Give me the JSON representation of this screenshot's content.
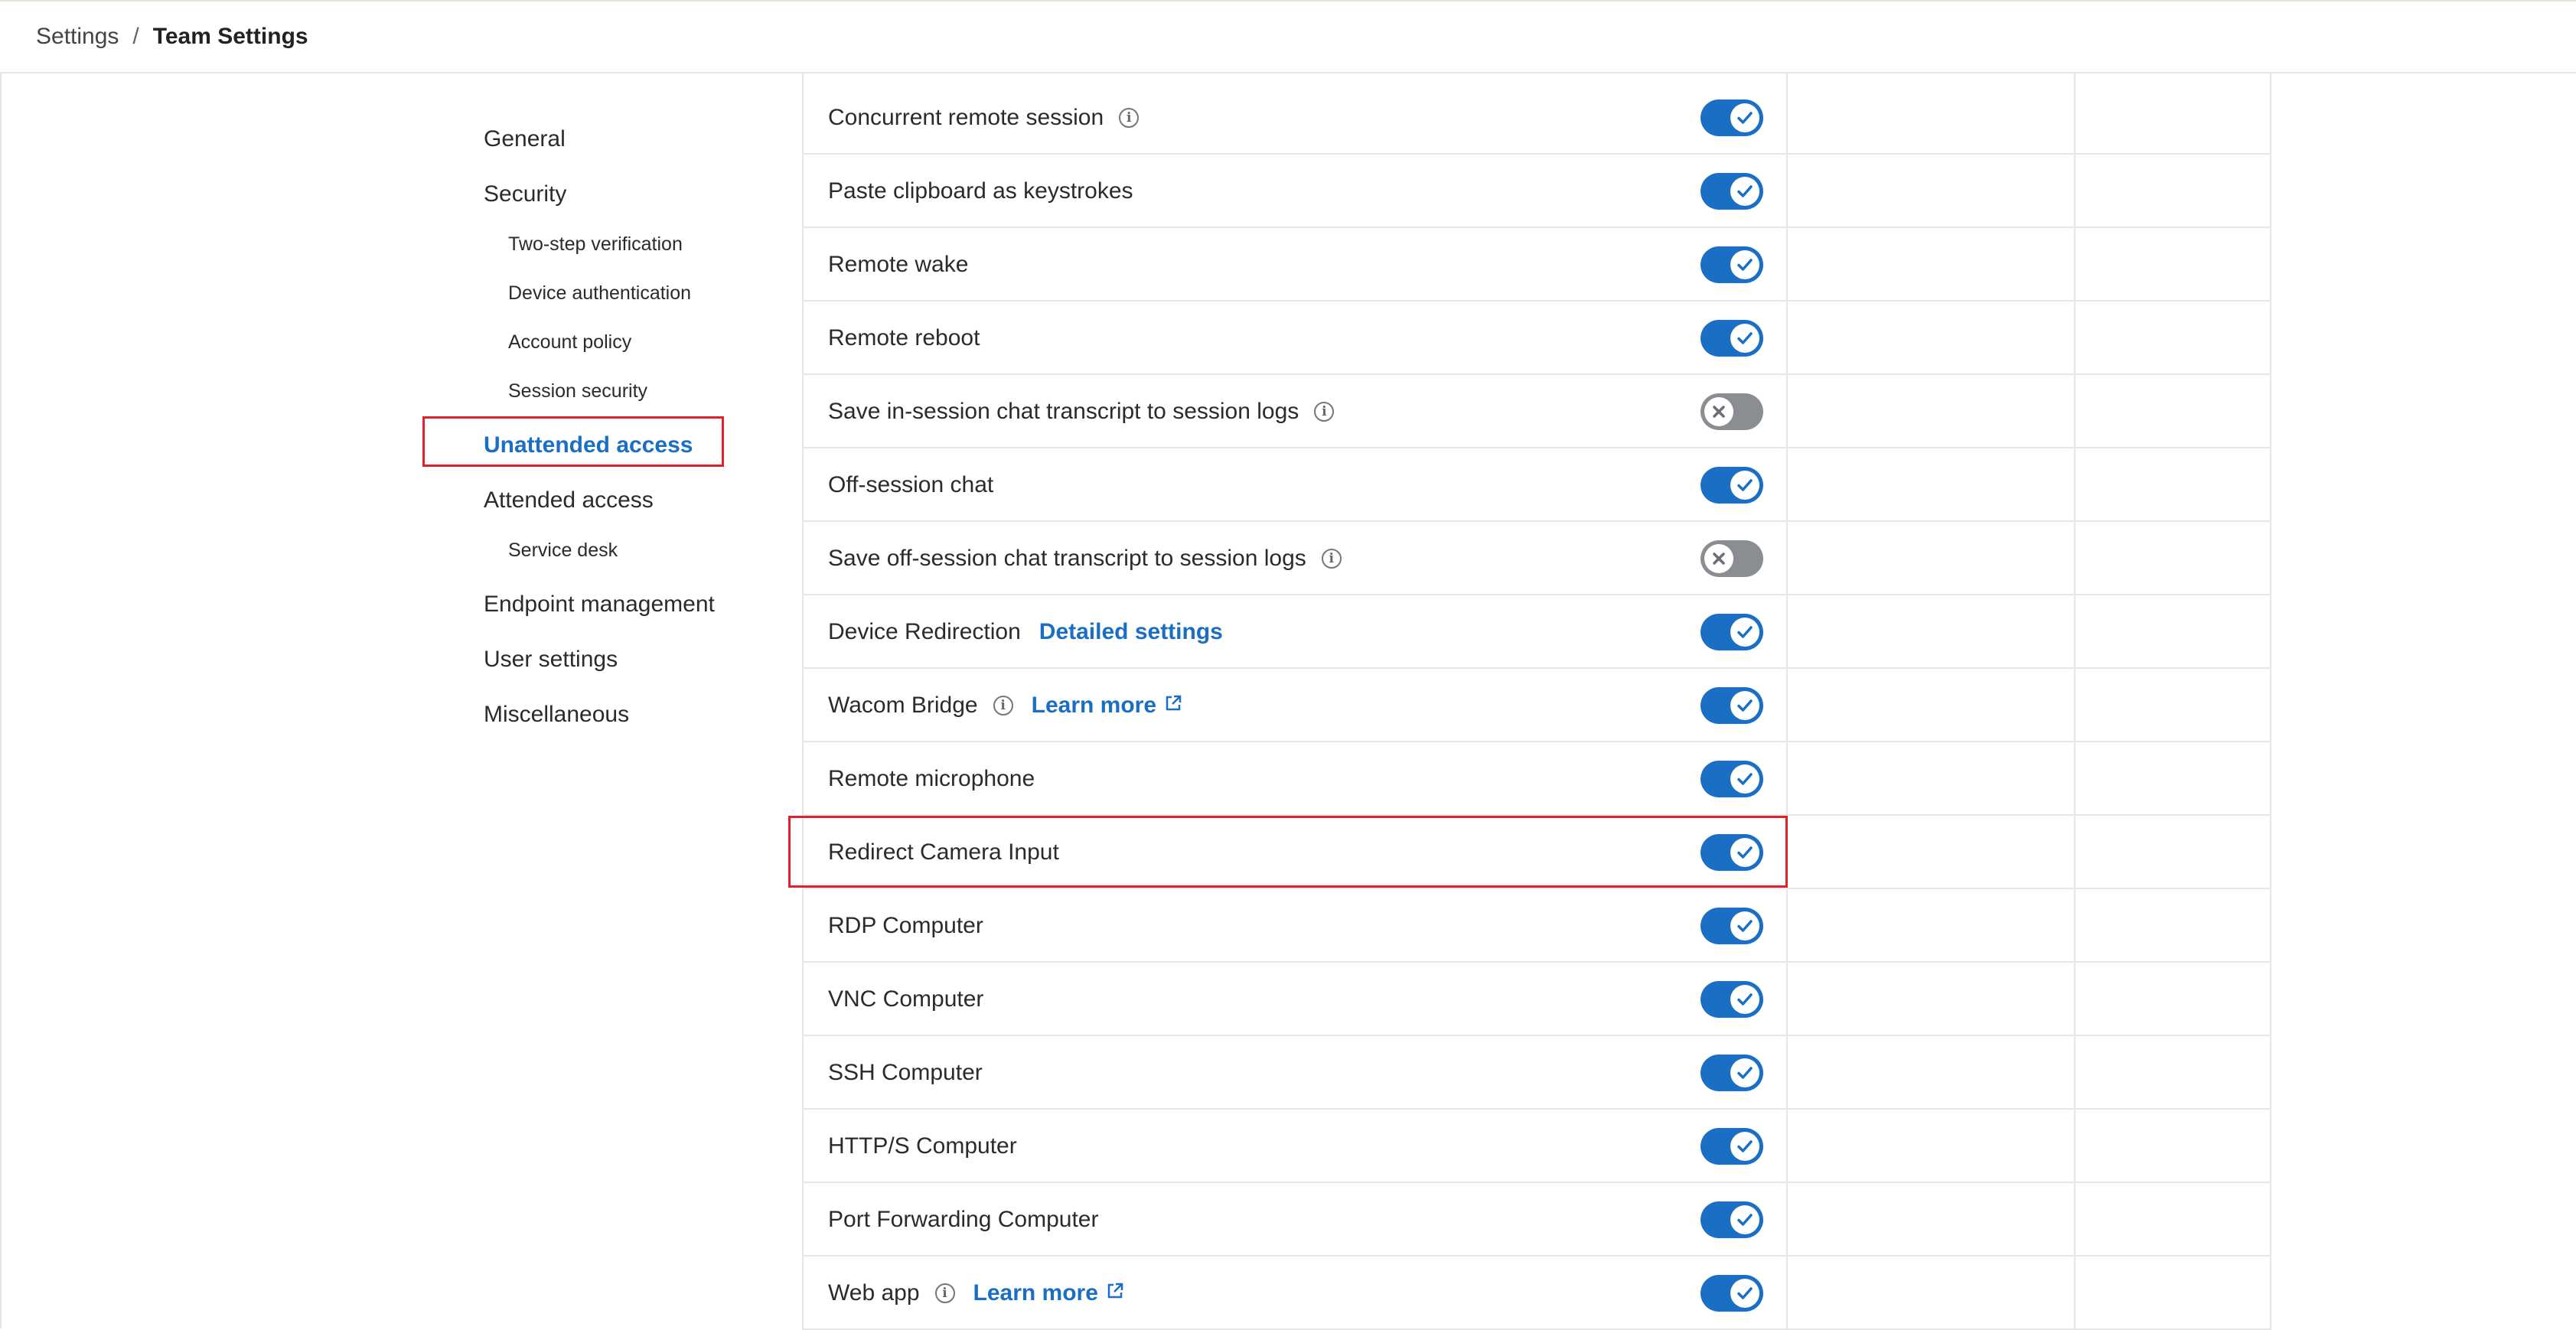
{
  "breadcrumb": {
    "root": "Settings",
    "separator": "/",
    "current": "Team Settings"
  },
  "sidebar": {
    "items": [
      {
        "label": "General",
        "level": "top",
        "active": false
      },
      {
        "label": "Security",
        "level": "top",
        "active": false
      },
      {
        "label": "Two-step verification",
        "level": "sub",
        "active": false
      },
      {
        "label": "Device authentication",
        "level": "sub",
        "active": false
      },
      {
        "label": "Account policy",
        "level": "sub",
        "active": false
      },
      {
        "label": "Session security",
        "level": "sub",
        "active": false
      },
      {
        "label": "Unattended access",
        "level": "top",
        "active": true
      },
      {
        "label": "Attended access",
        "level": "top",
        "active": false
      },
      {
        "label": "Service desk",
        "level": "sub",
        "active": false
      },
      {
        "label": "Endpoint management",
        "level": "top",
        "active": false
      },
      {
        "label": "User settings",
        "level": "top",
        "active": false
      },
      {
        "label": "Miscellaneous",
        "level": "top",
        "active": false
      }
    ]
  },
  "settings": {
    "rows": [
      {
        "label": "Concurrent remote session",
        "info": true,
        "link": "",
        "enabled": true
      },
      {
        "label": "Paste clipboard as keystrokes",
        "info": false,
        "link": "",
        "enabled": true
      },
      {
        "label": "Remote wake",
        "info": false,
        "link": "",
        "enabled": true
      },
      {
        "label": "Remote reboot",
        "info": false,
        "link": "",
        "enabled": true
      },
      {
        "label": "Save in-session chat transcript to session logs",
        "info": true,
        "link": "",
        "enabled": false
      },
      {
        "label": "Off-session chat",
        "info": false,
        "link": "",
        "enabled": true
      },
      {
        "label": "Save off-session chat transcript to session logs",
        "info": true,
        "link": "",
        "enabled": false
      },
      {
        "label": "Device Redirection",
        "info": false,
        "link": "Detailed settings",
        "external": false,
        "enabled": true
      },
      {
        "label": "Wacom Bridge",
        "info": true,
        "link": "Learn more",
        "external": true,
        "enabled": true
      },
      {
        "label": "Remote microphone",
        "info": false,
        "link": "",
        "enabled": true
      },
      {
        "label": "Redirect Camera Input",
        "info": false,
        "link": "",
        "enabled": true,
        "highlighted": true
      },
      {
        "label": "RDP Computer",
        "info": false,
        "link": "",
        "enabled": true
      },
      {
        "label": "VNC Computer",
        "info": false,
        "link": "",
        "enabled": true
      },
      {
        "label": "SSH Computer",
        "info": false,
        "link": "",
        "enabled": true
      },
      {
        "label": "HTTP/S Computer",
        "info": false,
        "link": "",
        "enabled": true
      },
      {
        "label": "Port Forwarding Computer",
        "info": false,
        "link": "",
        "enabled": true
      },
      {
        "label": "Web app",
        "info": true,
        "link": "Learn more",
        "external": true,
        "enabled": true
      }
    ]
  },
  "colors": {
    "accent": "#1a6fc4",
    "toggle_off": "#8a8d92",
    "highlight": "#e0202b"
  },
  "icons": {
    "info": "info-icon",
    "external": "external-link-icon",
    "check": "check-icon",
    "x": "close-icon"
  }
}
